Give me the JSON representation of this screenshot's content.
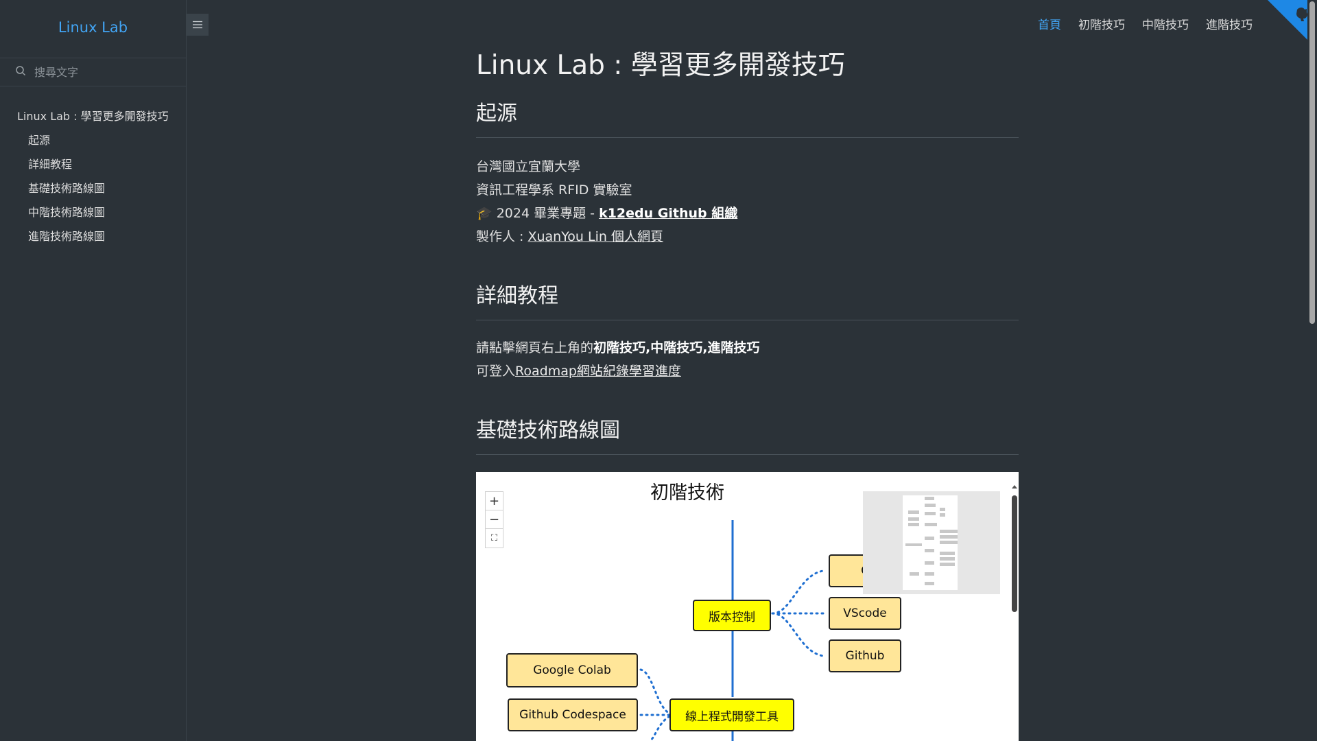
{
  "sidebar": {
    "app_name": "Linux Lab",
    "search_placeholder": "搜尋文字",
    "toc": [
      {
        "label": "Linux Lab : 學習更多開發技巧"
      },
      {
        "label": "起源"
      },
      {
        "label": "詳細教程"
      },
      {
        "label": "基礎技術路線圖"
      },
      {
        "label": "中階技術路線圖"
      },
      {
        "label": "進階技術路線圖"
      }
    ]
  },
  "nav": {
    "items": [
      {
        "label": "首頁",
        "active": true
      },
      {
        "label": "初階技巧"
      },
      {
        "label": "中階技巧"
      },
      {
        "label": "進階技巧"
      }
    ]
  },
  "page": {
    "title": "Linux Lab : 學習更多開發技巧",
    "origin": {
      "heading": "起源",
      "line1": "台灣國立宜蘭大學",
      "line2": "資訊工程學系 RFID 實驗室",
      "line3_emoji": "🎓",
      "line3_prefix": "2024 畢業專題 - ",
      "line3_link": "k12edu Github 組織",
      "line4_prefix": "製作人 : ",
      "line4_link": "XuanYou Lin 個人網頁"
    },
    "tutorial": {
      "heading": "詳細教程",
      "line1_prefix": "請點擊網頁右上角的",
      "line1_bold": "初階技巧,中階技巧,進階技巧",
      "line2_prefix": "可登入",
      "line2_link": "Roadmap網站紀錄學習進度"
    },
    "basic_roadmap": {
      "heading": "基礎技術路線圖"
    }
  },
  "diagram": {
    "title": "初階技術",
    "zoom_in": "+",
    "zoom_out": "−",
    "fit": "⛶",
    "nodes": {
      "version_control": "版本控制",
      "vscode": "VScode",
      "github": "Github",
      "partial": "C",
      "online_tools": "線上程式開發工具",
      "google_colab": "Google Colab",
      "github_codespace": "Github Codespace"
    }
  },
  "colors": {
    "background": "#2b3238",
    "accent": "#42a5f5",
    "node_primary": "#ffff00",
    "node_secondary": "#ffe699",
    "connector": "#1f6fd1"
  }
}
